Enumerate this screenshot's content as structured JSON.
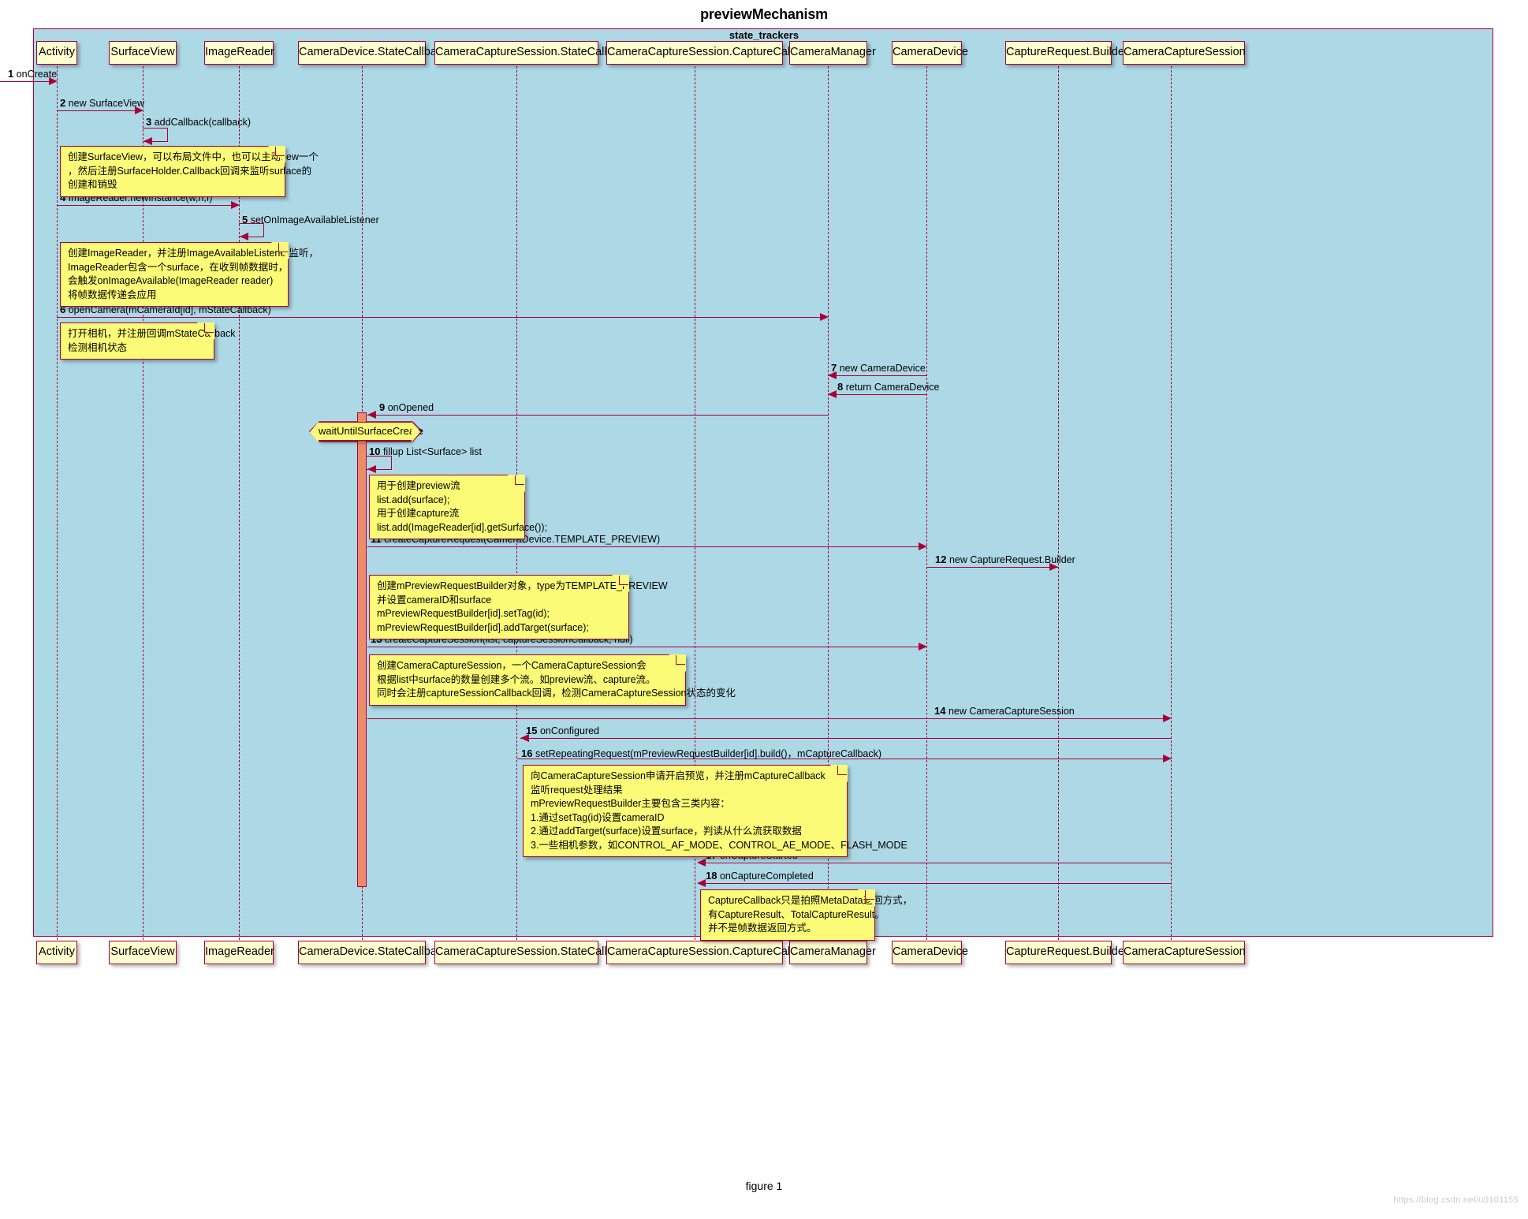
{
  "diagram": {
    "title": "previewMechanism",
    "frame_label": "state_trackers",
    "caption": "figure 1",
    "watermark": "https://blog.csdn.net/u0101155",
    "colors": {
      "frame_fill": "#ADD8E6",
      "participant_fill": "#FEFECE",
      "note_fill": "#FBFB77",
      "line": "#A80036",
      "activation": "#EE8B6E"
    }
  },
  "participants": [
    {
      "id": "activity",
      "label": "Activity"
    },
    {
      "id": "surfaceview",
      "label": "SurfaceView"
    },
    {
      "id": "imagereader",
      "label": "ImageReader"
    },
    {
      "id": "devstate",
      "label": "CameraDevice.StateCallback"
    },
    {
      "id": "sessstate",
      "label": "CameraCaptureSession.StateCallback"
    },
    {
      "id": "sesscapture",
      "label": "CameraCaptureSession.CaptureCallback"
    },
    {
      "id": "cameramgr",
      "label": "CameraManager"
    },
    {
      "id": "cameradev",
      "label": "CameraDevice"
    },
    {
      "id": "reqbuilder",
      "label": "CaptureRequest.Builder"
    },
    {
      "id": "capsession",
      "label": "CameraCaptureSession"
    }
  ],
  "messages": [
    {
      "num": "1",
      "text": "onCreate"
    },
    {
      "num": "2",
      "text": "new SurfaceView"
    },
    {
      "num": "3",
      "text": "addCallback(callback)"
    },
    {
      "num": "4",
      "text": "ImageReader.newInstance(w,h,f)"
    },
    {
      "num": "5",
      "text": "setOnImageAvailableListener"
    },
    {
      "num": "6",
      "text": "openCamera(mCameraId[id], mStateCallback)"
    },
    {
      "num": "7",
      "text": "new CameraDevice"
    },
    {
      "num": "8",
      "text": "return CameraDevice"
    },
    {
      "num": "9",
      "text": "onOpened"
    },
    {
      "num": "10",
      "text": "fillup List<Surface> list"
    },
    {
      "num": "11",
      "text": "createCaptureRequest(CameraDevice.TEMPLATE_PREVIEW)"
    },
    {
      "num": "12",
      "text": "new CaptureRequest.Builder"
    },
    {
      "num": "13",
      "text": "createCaptureSession(list, captureSessionCallback, null)"
    },
    {
      "num": "14",
      "text": "new CameraCaptureSession"
    },
    {
      "num": "15",
      "text": "onConfigured"
    },
    {
      "num": "16",
      "text": "setRepeatingRequest(mPreviewRequestBuilder[id].build()，mCaptureCallback)"
    },
    {
      "num": "17",
      "text": "onCaptureStarted"
    },
    {
      "num": "18",
      "text": "onCaptureCompleted"
    }
  ],
  "delay": {
    "label": "waitUntilSurfaceCreate"
  },
  "notes": [
    {
      "id": "note1",
      "text": "创建SurfaceView，可以布局文件中，也可以主动new一个\n，然后注册SurfaceHolder.Callback回调来监听surface的\n创建和销毁"
    },
    {
      "id": "note2",
      "text": "创建ImageReader，并注册ImageAvailableListener监听，\nImageReader包含一个surface，在收到帧数据时，\n会触发onImageAvailable(ImageReader reader)\n将帧数据传递会应用"
    },
    {
      "id": "note3",
      "text": "打开相机，并注册回调mStateCallback\n检测相机状态"
    },
    {
      "id": "note4",
      "text": "用于创建preview流\nlist.add(surface);\n用于创建capture流\nlist.add(ImageReader[id].getSurface());"
    },
    {
      "id": "note5",
      "text": "创建mPreviewRequestBuilder对象，type为TEMPLATE_PREVIEW\n并设置cameraID和surface\nmPreviewRequestBuilder[id].setTag(id);\nmPreviewRequestBuilder[id].addTarget(surface);"
    },
    {
      "id": "note6",
      "text": "创建CameraCaptureSession，一个CameraCaptureSession会\n根据list中surface的数量创建多个流。如preview流、capture流。\n同时会注册captureSessionCallback回调，检测CameraCaptureSession状态的变化"
    },
    {
      "id": "note7",
      "text": "向CameraCaptureSession申请开启预览，并注册mCaptureCallback\n监听request处理结果\nmPreviewRequestBuilder主要包含三类内容：\n1.通过setTag(id)设置cameraID\n2.通过addTarget(surface)设置surface，判读从什么流获取数据\n3.一些相机参数，如CONTROL_AF_MODE、CONTROL_AE_MODE、FLASH_MODE"
    },
    {
      "id": "note8",
      "text": "CaptureCallback只是拍照MetaData返回方式，\n有CaptureResult、TotalCaptureResult。\n并不是帧数据返回方式。"
    }
  ]
}
